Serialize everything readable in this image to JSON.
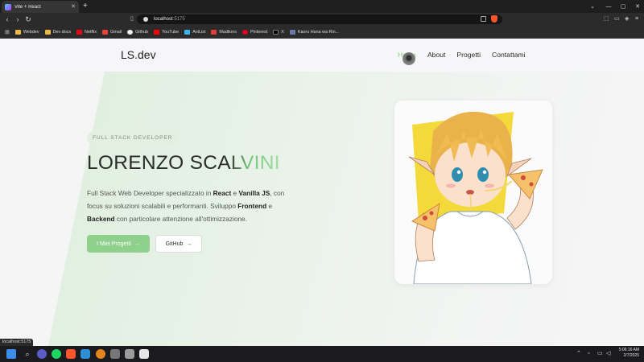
{
  "browser": {
    "tab_title": "Vite + React",
    "url_host": "localhost",
    "url_port": ":5175",
    "status_url": "localhost:5175"
  },
  "bookmarks": [
    {
      "label": "Webdev",
      "color": "#e9b949"
    },
    {
      "label": "Dev docs",
      "color": "#e9b949"
    },
    {
      "label": "Netflix",
      "color": "#e50914"
    },
    {
      "label": "Gmail",
      "color": "#ea4335"
    },
    {
      "label": "Github",
      "color": "#f0f0f0"
    },
    {
      "label": "YouTube",
      "color": "#ff0000"
    },
    {
      "label": "AniList",
      "color": "#3db4f2"
    },
    {
      "label": "Madlions",
      "color": "#e23b3b"
    },
    {
      "label": "Pinterest",
      "color": "#e60023"
    },
    {
      "label": "X",
      "color": "#000000"
    },
    {
      "label": "Kaoru Hana wa Rin...",
      "color": "#6b7aa8"
    }
  ],
  "site": {
    "logo": "LS.dev",
    "nav": [
      {
        "label": "Home",
        "active": true
      },
      {
        "label": "About",
        "active": false
      },
      {
        "label": "Progetti",
        "active": false
      },
      {
        "label": "Contattami",
        "active": false
      }
    ]
  },
  "hero": {
    "badge": "FULL STACK DEVELOPER",
    "name_dark": "LORENZO SCA",
    "name_highlight": "LVINI",
    "desc_1": "Full Stack Web Developer specializzato in ",
    "react": "React",
    "desc_2": " e ",
    "vanilla": "Vanilla JS",
    "desc_3": ", con focus su soluzioni scalabili e performanti. Sviluppo ",
    "frontend": "Frontend",
    "desc_4": " e ",
    "backend": "Backend",
    "desc_5": " con particolare attenzione all'ottimizzazione.",
    "btn_primary": "I Miei Progetti",
    "btn_secondary": "GitHub",
    "arrow": "→"
  },
  "taskbar": {
    "time": "5:06:16 AM",
    "date": "2/7/2025"
  },
  "colors": {
    "accent_green": "#8fd08d",
    "nav_active": "#8bd38b"
  }
}
